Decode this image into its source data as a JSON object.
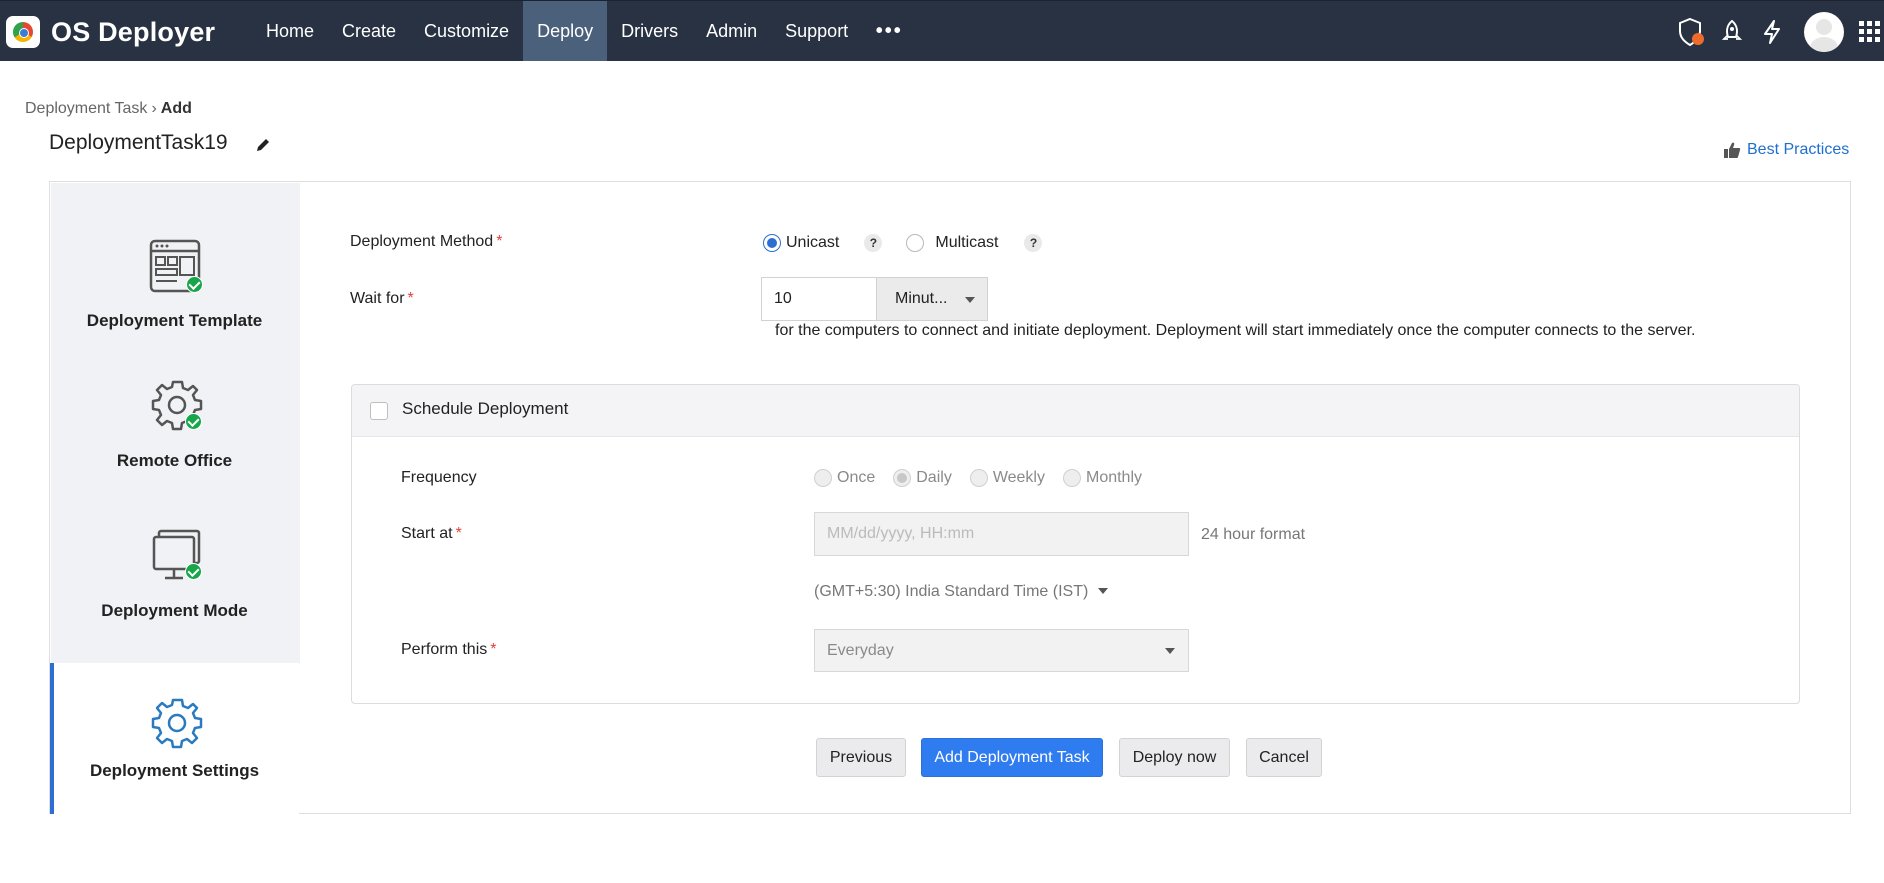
{
  "app": {
    "name": "OS Deployer"
  },
  "nav": {
    "items": [
      "Home",
      "Create",
      "Customize",
      "Deploy",
      "Drivers",
      "Admin",
      "Support"
    ],
    "more": "•••",
    "active": "Deploy"
  },
  "top_icons": [
    "shield-alert-icon",
    "rocket-icon",
    "lightning-icon",
    "user-avatar",
    "app-grid-icon"
  ],
  "breadcrumb": {
    "parent": "Deployment Task",
    "current": "Add"
  },
  "page_title": "DeploymentTask19",
  "best_practices": "Best Practices",
  "steps": [
    {
      "label": "Deployment Template",
      "icon": "template-icon",
      "completed": true
    },
    {
      "label": "Remote Office",
      "icon": "gear-icon",
      "completed": true
    },
    {
      "label": "Deployment Mode",
      "icon": "monitor-icon",
      "completed": true
    },
    {
      "label": "Deployment Settings",
      "icon": "gear-icon",
      "completed": false,
      "active": true
    }
  ],
  "form": {
    "deployment_method": {
      "label": "Deployment Method",
      "options": [
        "Unicast",
        "Multicast"
      ],
      "selected": "Unicast",
      "help": "?"
    },
    "wait_for": {
      "label": "Wait for",
      "value": "10",
      "unit": "Minut...",
      "help_text": "for the computers to connect and initiate deployment. Deployment will start immediately once the computer connects to the server."
    },
    "schedule": {
      "label": "Schedule Deployment",
      "checked": false,
      "frequency": {
        "label": "Frequency",
        "options": [
          "Once",
          "Daily",
          "Weekly",
          "Monthly"
        ],
        "selected": "Daily"
      },
      "start_at": {
        "label": "Start at",
        "placeholder": "MM/dd/yyyy, HH:mm",
        "note": "24 hour format"
      },
      "timezone": "(GMT+5:30) India Standard Time (IST)",
      "perform_this": {
        "label": "Perform this",
        "value": "Everyday"
      }
    }
  },
  "buttons": {
    "previous": "Previous",
    "add": "Add Deployment Task",
    "deploy_now": "Deploy now",
    "cancel": "Cancel"
  },
  "colors": {
    "topbar": "#283242",
    "nav_active": "#4b607a",
    "accent": "#2f7cf0",
    "link": "#1f6fd1",
    "success": "#18a64a",
    "required": "#e2403a"
  }
}
